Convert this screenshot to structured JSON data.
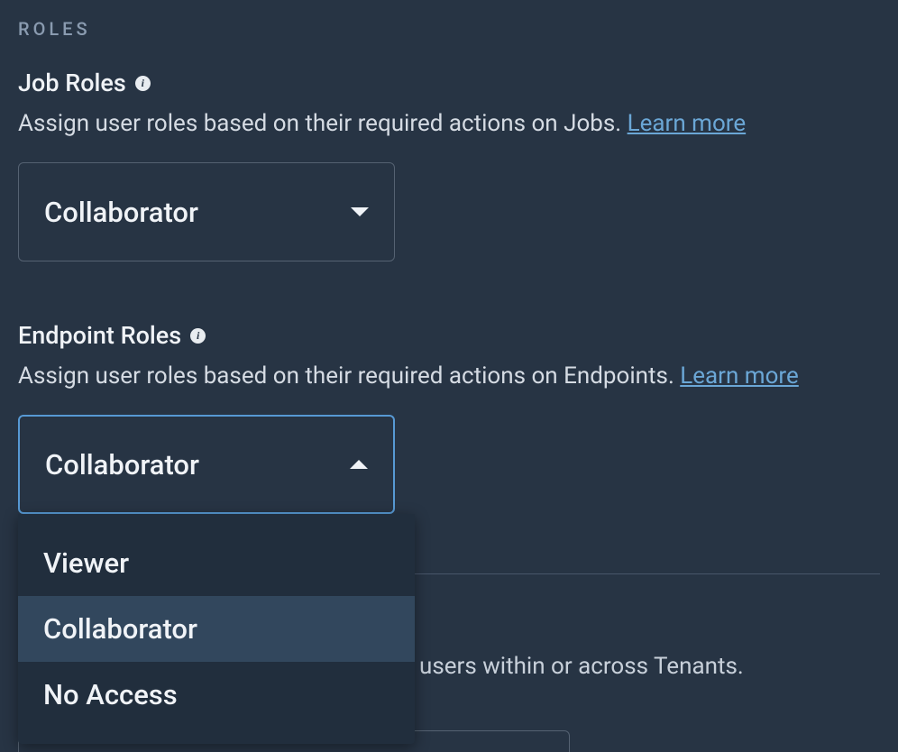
{
  "section": {
    "header": "ROLES"
  },
  "jobRoles": {
    "label": "Job Roles",
    "description": "Assign user roles based on their required actions on Jobs. ",
    "learnMore": "Learn more",
    "selected": "Collaborator"
  },
  "endpointRoles": {
    "label": "Endpoint Roles",
    "description": "Assign user roles based on their required actions on Endpoints. ",
    "learnMore": "Learn more",
    "selected": "Collaborator",
    "options": [
      {
        "label": "Viewer"
      },
      {
        "label": "Collaborator"
      },
      {
        "label": "No Access"
      }
    ]
  },
  "partial": {
    "trailingText": "users within or across Tenants."
  }
}
